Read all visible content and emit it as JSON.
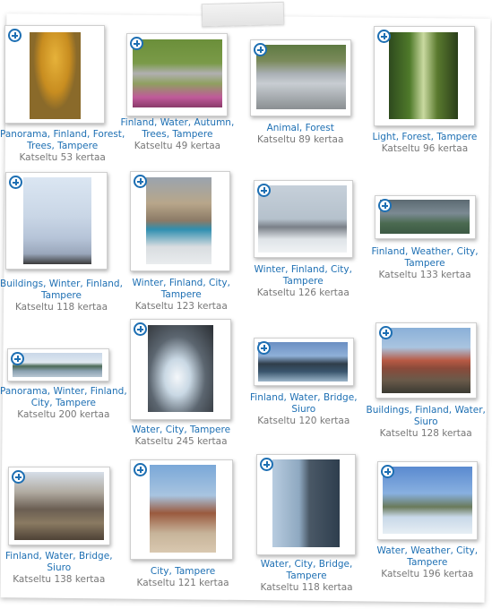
{
  "views_label": "Katseltu",
  "views_suffix": "kertaa",
  "items": [
    {
      "tags": [
        "Panorama",
        "Finland",
        "Forest",
        "Trees",
        "Tampere"
      ],
      "lines": [
        3,
        2
      ],
      "views": "53"
    },
    {
      "tags": [
        "Finland",
        "Water",
        "Autumn",
        "Trees",
        "Tampere"
      ],
      "lines": [
        3,
        2
      ],
      "views": "49"
    },
    {
      "tags": [
        "Animal",
        "Forest"
      ],
      "lines": [
        2
      ],
      "views": "89"
    },
    {
      "tags": [
        "Light",
        "Forest",
        "Tampere"
      ],
      "lines": [
        3
      ],
      "views": "96"
    },
    {
      "tags": [
        "Buildings",
        "Winter",
        "Finland",
        "Tampere"
      ],
      "lines": [
        3,
        1
      ],
      "views": "118"
    },
    {
      "tags": [
        "Winter",
        "Finland",
        "City",
        "Tampere"
      ],
      "lines": [
        3,
        1
      ],
      "views": "123"
    },
    {
      "tags": [
        "Winter",
        "Finland",
        "City",
        "Tampere"
      ],
      "lines": [
        3,
        1
      ],
      "views": "126"
    },
    {
      "tags": [
        "Finland",
        "Weather",
        "City",
        "Tampere"
      ],
      "lines": [
        3,
        1
      ],
      "views": "133"
    },
    {
      "tags": [
        "Panorama",
        "Winter",
        "Finland",
        "City",
        "Tampere"
      ],
      "lines": [
        3,
        2
      ],
      "views": "200"
    },
    {
      "tags": [
        "Water",
        "City",
        "Tampere"
      ],
      "lines": [
        3
      ],
      "views": "245"
    },
    {
      "tags": [
        "Finland",
        "Water",
        "Bridge",
        "Siuro"
      ],
      "lines": [
        3,
        1
      ],
      "views": "120"
    },
    {
      "tags": [
        "Buildings",
        "Finland",
        "Water",
        "Siuro"
      ],
      "lines": [
        3,
        1
      ],
      "views": "128"
    },
    {
      "tags": [
        "Finland",
        "Water",
        "Bridge",
        "Siuro"
      ],
      "lines": [
        3,
        1
      ],
      "views": "138"
    },
    {
      "tags": [
        "City",
        "Tampere"
      ],
      "lines": [
        2
      ],
      "views": "121"
    },
    {
      "tags": [
        "Water",
        "City",
        "Bridge",
        "Tampere"
      ],
      "lines": [
        3,
        1
      ],
      "views": "118"
    },
    {
      "tags": [
        "Water",
        "Weather",
        "City",
        "Tampere"
      ],
      "lines": [
        3,
        1
      ],
      "views": "196"
    }
  ]
}
